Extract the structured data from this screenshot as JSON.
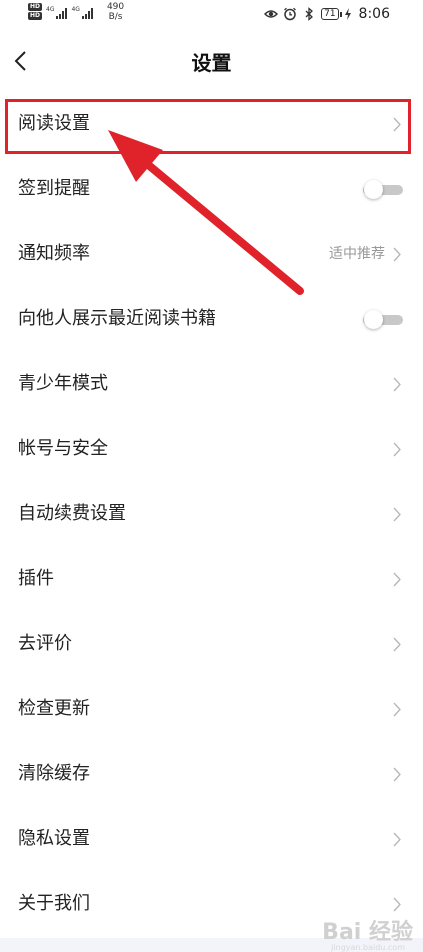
{
  "status_bar": {
    "hd1": "HD",
    "hd2": "HD",
    "net1": "4G",
    "net2": "4G",
    "speed_value": "490",
    "speed_unit": "B/s",
    "battery": "71",
    "time": "8:06"
  },
  "header": {
    "title": "设置"
  },
  "settings": {
    "items": [
      {
        "label": "阅读设置"
      },
      {
        "label": "签到提醒",
        "toggle": false
      },
      {
        "label": "通知频率",
        "value": "适中推荐"
      },
      {
        "label": "向他人展示最近阅读书籍",
        "toggle": false
      },
      {
        "label": "青少年模式"
      },
      {
        "label": "帐号与安全"
      },
      {
        "label": "自动续费设置"
      },
      {
        "label": "插件"
      },
      {
        "label": "去评价"
      },
      {
        "label": "检查更新"
      },
      {
        "label": "清除缓存"
      },
      {
        "label": "隐私设置"
      },
      {
        "label": "关于我们"
      }
    ]
  },
  "watermark": {
    "text": "Bai 经验",
    "sub": "jingyan.baidu.com"
  },
  "colors": {
    "annotation_red": "#e0222b",
    "toggle_off": "#c8c8c8"
  }
}
